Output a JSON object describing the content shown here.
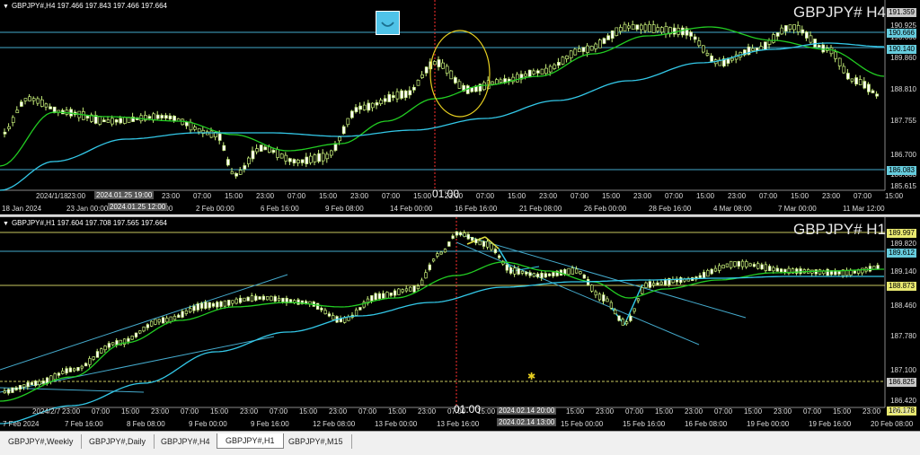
{
  "top_chart": {
    "info": "GBPJPY#,H4  197.466 197.843 197.466 197.664",
    "title": "GBPJPY# H4",
    "price_labels": [
      "191.359",
      "190.925",
      "190.666",
      "190.140",
      "189.860",
      "188.810",
      "187.755",
      "186.700",
      "186.083",
      "185.615"
    ],
    "tags": [
      {
        "text": "191.359",
        "color": "#c8c8c8"
      },
      {
        "text": "190.666",
        "color": "#66ccdd"
      },
      {
        "text": "190.140",
        "color": "#66ccdd"
      },
      {
        "text": "186.083",
        "color": "#66ccdd"
      }
    ],
    "time_labels": [
      "2024/1/18",
      "23:00",
      "07:00",
      "15:00",
      "23:00",
      "07:00",
      "15:00",
      "23:00",
      "07:00",
      "15:00",
      "23:00",
      "07:00",
      "15:00",
      "23:00",
      "07:00",
      "15:00",
      "23:00",
      "07:00",
      "15:00",
      "23:00",
      "07:00",
      "15:00",
      "23:00",
      "07:00",
      "15:00",
      "23:00",
      "07:00",
      "15:00"
    ],
    "date_labels": [
      "18 Jan 2024",
      "23 Jan 00:00",
      "30 Jan 08:00",
      "2 Feb 00:00",
      "6 Feb 16:00",
      "9 Feb 08:00",
      "14 Feb 00:00",
      "16 Feb 16:00",
      "21 Feb 08:00",
      "26 Feb 00:00",
      "28 Feb 16:00",
      "4 Mar 08:00",
      "7 Mar 00:00",
      "11 Mar 12:00"
    ],
    "time_boxes": [
      "2024.01.25 19:00",
      "2024.01.25 12:00"
    ],
    "cross_time": "01:00"
  },
  "bottom_chart": {
    "info": "GBPJPY#,H1  197.604 197.708 197.565 197.664",
    "title": "GBPJPY# H1",
    "price_labels": [
      "189.997",
      "189.820",
      "189.612",
      "189.140",
      "188.873",
      "188.460",
      "187.780",
      "187.100",
      "186.825",
      "186.420",
      "186.178"
    ],
    "tags": [
      {
        "text": "189.997",
        "color": "#e8e870"
      },
      {
        "text": "189.612",
        "color": "#66ccdd"
      },
      {
        "text": "188.873",
        "color": "#e8e870"
      },
      {
        "text": "186.825",
        "color": "#c8c8c8"
      },
      {
        "text": "186.178",
        "color": "#e8e870"
      }
    ],
    "time_labels": [
      "2024/2/7",
      "23:00",
      "07:00",
      "15:00",
      "23:00",
      "07:00",
      "15:00",
      "23:00",
      "07:00",
      "15:00",
      "23:00",
      "07:00",
      "15:00",
      "23:00",
      "07:00",
      "15:00",
      "23:00",
      "07:00",
      "15:00",
      "23:00",
      "07:00",
      "15:00",
      "23:00",
      "07:00",
      "15:00",
      "23:00",
      "07:00",
      "15:00",
      "23:00",
      "07:00"
    ],
    "date_labels": [
      "7 Feb 2024",
      "7 Feb 16:00",
      "8 Feb 08:00",
      "9 Feb 00:00",
      "9 Feb 16:00",
      "12 Feb 08:00",
      "13 Feb 00:00",
      "13 Feb 16:00",
      "14 Feb 08:00",
      "15 Feb 00:00",
      "15 Feb 16:00",
      "16 Feb 08:00",
      "19 Feb 00:00",
      "19 Feb 16:00",
      "20 Feb 08:00"
    ],
    "time_boxes": [
      "2024.02.14 20:00",
      "2024.02.14 13:00"
    ],
    "cross_time": "01:00"
  },
  "tabs": [
    "GBPJPY#,Weekly",
    "GBPJPY#,Daily",
    "GBPJPY#,H4",
    "GBPJPY#,H1",
    "GBPJPY#,M15"
  ],
  "active_tab": "GBPJPY#,H1",
  "colors": {
    "bull": "#ffffff",
    "bear": "#ffffff",
    "wick": "#c8f07a",
    "ma_green": "#22cc22",
    "ma_cyan": "#33c8e8",
    "hline_cyan": "#44aacc",
    "hline_yellow": "#c8c860",
    "crosshair": "#ff3030",
    "annotation": "#e8d020"
  },
  "icons": [
    "smile-icon"
  ]
}
